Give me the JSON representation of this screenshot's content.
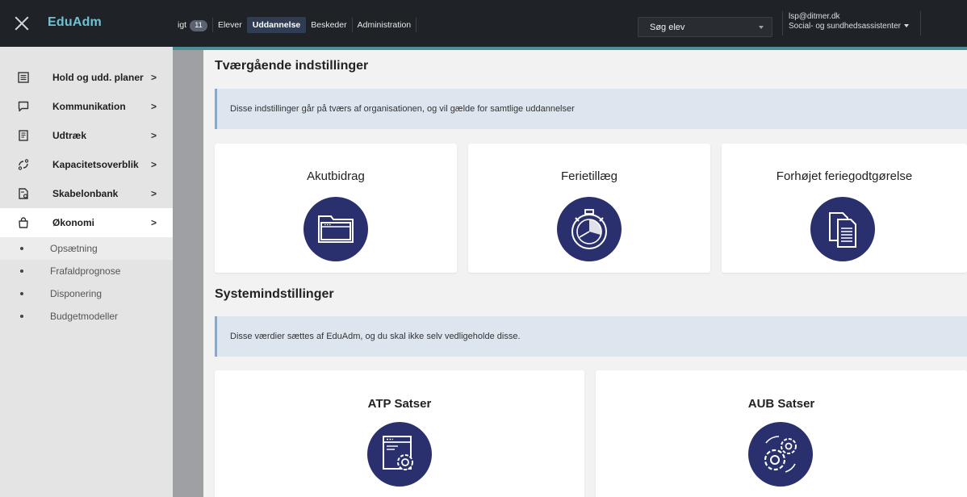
{
  "app": {
    "brand": "EduAdm"
  },
  "nav": {
    "overview_label": "igt",
    "overview_badge": "11",
    "items": [
      {
        "label": "Elever"
      },
      {
        "label": "Uddannelse"
      },
      {
        "label": "Beskeder"
      },
      {
        "label": "Administration"
      }
    ],
    "active": "Uddannelse"
  },
  "search": {
    "placeholder": "Søg elev"
  },
  "user": {
    "email": "lsp@ditmer.dk",
    "role": "Social- og sundhedsassistenter"
  },
  "sidebar": {
    "items": [
      {
        "label": "Hold og udd. planer",
        "icon": "list-icon"
      },
      {
        "label": "Kommunikation",
        "icon": "chat-icon"
      },
      {
        "label": "Udtræk",
        "icon": "document-icon"
      },
      {
        "label": "Kapacitetsoverblik",
        "icon": "capacity-icon"
      },
      {
        "label": "Skabelonbank",
        "icon": "template-icon"
      },
      {
        "label": "Økonomi",
        "icon": "bag-icon"
      }
    ],
    "subitems": [
      {
        "label": "Opsætning"
      },
      {
        "label": "Frafaldprognose"
      },
      {
        "label": "Disponering"
      },
      {
        "label": "Budgetmodeller"
      }
    ]
  },
  "main": {
    "section1": {
      "title": "Tværgående indstillinger",
      "info": "Disse indstillinger går på tværs af organisationen, og vil gælde for samtlige uddannelser",
      "cards": [
        {
          "title": "Akutbidrag",
          "icon": "folder-window-icon"
        },
        {
          "title": "Ferietillæg",
          "icon": "stopwatch-icon"
        },
        {
          "title": "Forhøjet feriegodtgørelse",
          "icon": "documents-icon"
        }
      ]
    },
    "section2": {
      "title": "Systemindstillinger",
      "info": "Disse værdier sættes af EduAdm, og du skal ikke selv vedligeholde disse.",
      "cards": [
        {
          "title": "ATP Satser",
          "icon": "settings-window-icon"
        },
        {
          "title": "AUB Satser",
          "icon": "gears-icon"
        }
      ]
    }
  },
  "colors": {
    "topbar": "#1f2227",
    "accent": "#4a8f95",
    "brand": "#6fc3d2",
    "icon_circle": "#2a2f6e"
  }
}
